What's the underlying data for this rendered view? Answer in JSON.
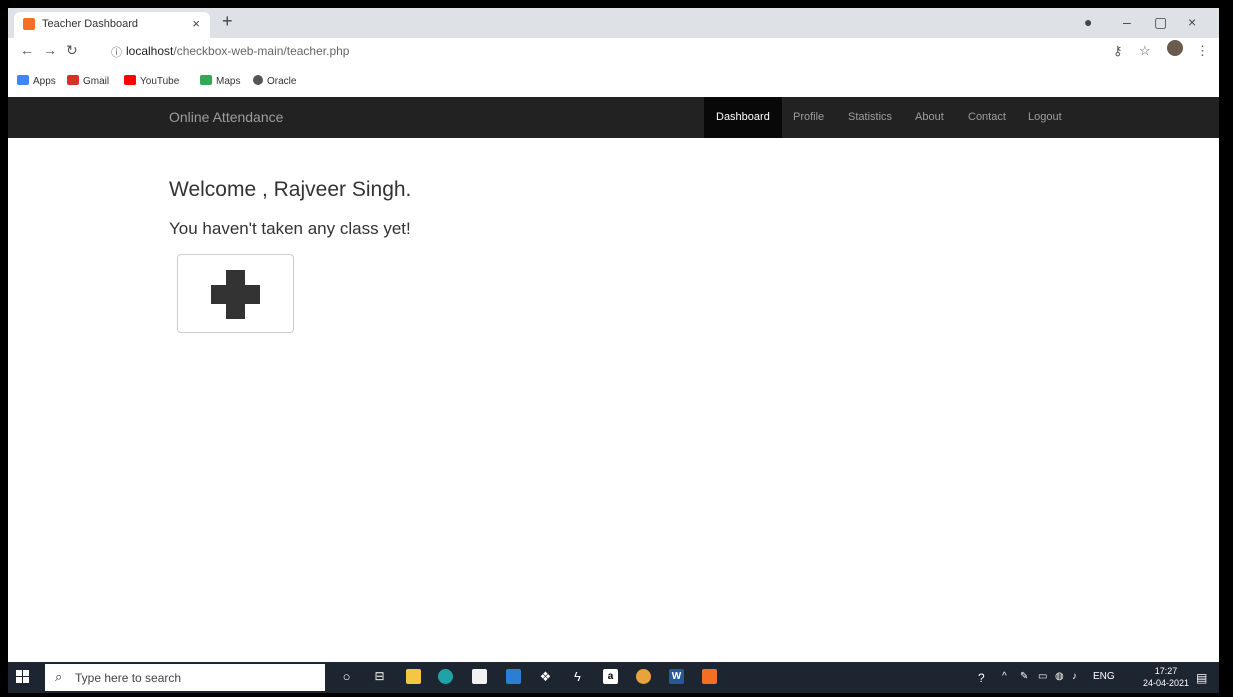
{
  "browser": {
    "tab_title": "Teacher Dashboard",
    "url_host": "localhost",
    "url_path": "/checkbox-web-main/teacher.php",
    "bookmarks": [
      "Apps",
      "Gmail",
      "YouTube",
      "Maps",
      "Oracle"
    ]
  },
  "app": {
    "brand": "Online Attendance",
    "nav": [
      "Dashboard",
      "Profile",
      "Statistics",
      "About",
      "Contact",
      "Logout"
    ],
    "active_nav": "Dashboard"
  },
  "content": {
    "welcome": "Welcome , Rajveer Singh.",
    "no_class": "You haven't taken any class yet!"
  },
  "taskbar": {
    "search_placeholder": "Type here to search",
    "lang": "ENG",
    "time": "17:27",
    "date": "24-04-2021"
  },
  "colors": {
    "navbar_bg": "#222222",
    "active_nav_bg": "#080808",
    "taskbar_bg": "#1c2530"
  }
}
